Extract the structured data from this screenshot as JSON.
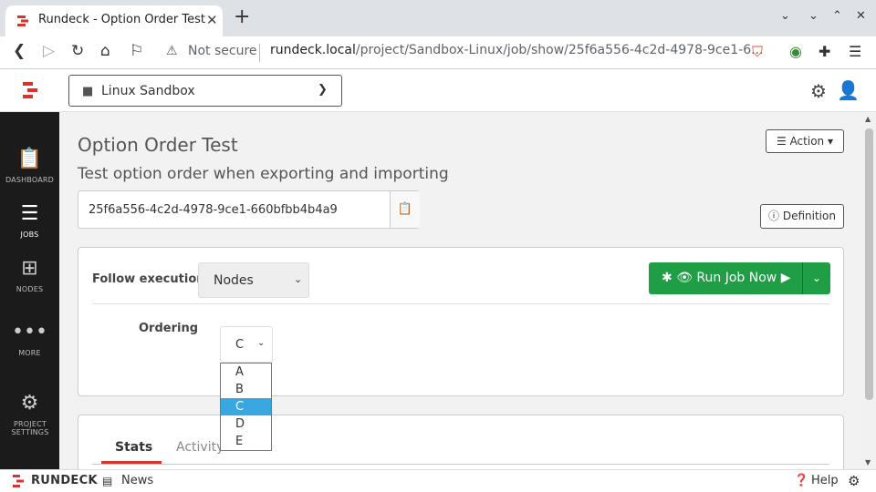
{
  "browser": {
    "tab_title": "Rundeck - Option Order Test",
    "tab_close": "✕",
    "new_tab": "+",
    "not_secure": "Not secure",
    "url_host": "rundeck.local",
    "url_path": "/project/Sandbox-Linux/job/show/25f6a556-4c2d-4978-9ce1-6..."
  },
  "header": {
    "project": "Linux Sandbox"
  },
  "sidebar": {
    "items": [
      {
        "label": "DASHBOARD",
        "icon": "clipboard-icon"
      },
      {
        "label": "JOBS",
        "icon": "list-check-icon"
      },
      {
        "label": "NODES",
        "icon": "sitemap-icon"
      },
      {
        "label": "MORE",
        "icon": "ellipsis-icon"
      },
      {
        "label": "PROJECT SETTINGS",
        "icon": "gears-icon"
      }
    ]
  },
  "job": {
    "title": "Option Order Test",
    "description": "Test option order when exporting and importing",
    "uuid": "25f6a556-4c2d-4978-9ce1-660bfbb4b4a9",
    "action_label": "Action",
    "definition_label": "Definition"
  },
  "run": {
    "follow_label": "Follow execution",
    "follow_value": "Nodes",
    "run_label": "Run Job Now",
    "option_label": "Ordering",
    "option_value": "C",
    "option_choices": [
      "A",
      "B",
      "C",
      "D",
      "E"
    ],
    "selected_index": 2
  },
  "tabs": {
    "stats": "Stats",
    "activity": "Activity"
  },
  "footer": {
    "brand": "RUNDECK",
    "news": "News",
    "help": "Help"
  },
  "colors": {
    "accent_red": "#d9342b",
    "run_green": "#1f9e45",
    "sidebar_bg": "#1b1b1b",
    "selected_option": "#3aa8e0"
  }
}
